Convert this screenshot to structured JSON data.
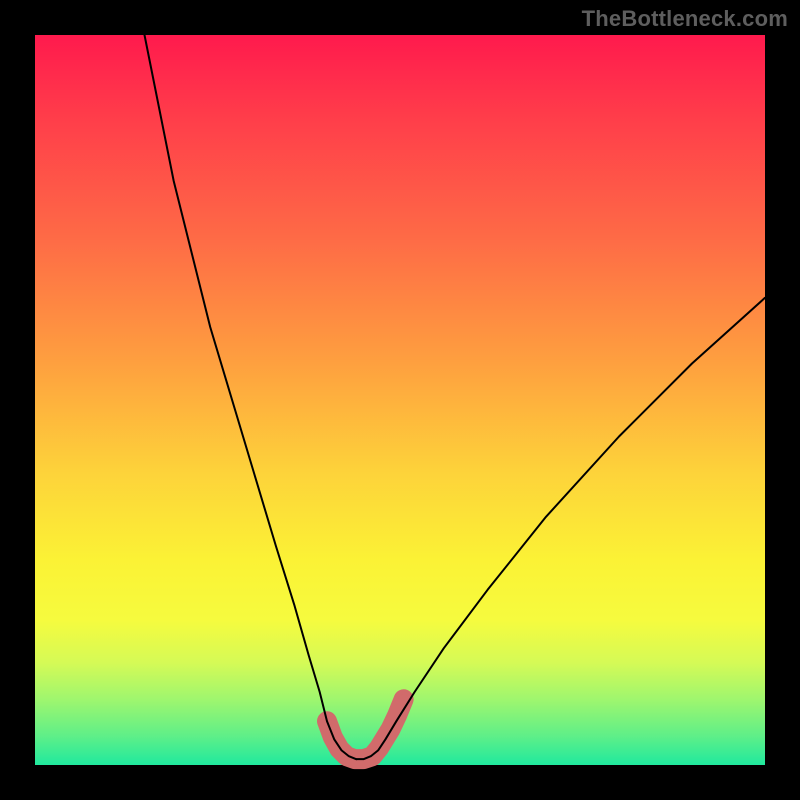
{
  "watermark": "TheBottleneck.com",
  "chart_data": {
    "type": "line",
    "title": "",
    "xlabel": "",
    "ylabel": "",
    "xlim": [
      0,
      100
    ],
    "ylim": [
      0,
      100
    ],
    "grid": false,
    "legend": false,
    "curves": {
      "left": {
        "stroke": "#000000",
        "width": 2,
        "points": [
          [
            15,
            100
          ],
          [
            17,
            90
          ],
          [
            19,
            80
          ],
          [
            21.5,
            70
          ],
          [
            24,
            60
          ],
          [
            27,
            50
          ],
          [
            30,
            40
          ],
          [
            33,
            30
          ],
          [
            35.5,
            22
          ],
          [
            37.5,
            15
          ],
          [
            39,
            10
          ],
          [
            40,
            6
          ],
          [
            41,
            3.5
          ],
          [
            42,
            2
          ],
          [
            43,
            1.2
          ],
          [
            44,
            0.8
          ]
        ]
      },
      "right": {
        "stroke": "#000000",
        "width": 2,
        "points": [
          [
            44,
            0.8
          ],
          [
            45,
            0.8
          ],
          [
            46,
            1.2
          ],
          [
            47,
            2
          ],
          [
            48,
            3.5
          ],
          [
            49.5,
            6
          ],
          [
            52,
            10
          ],
          [
            56,
            16
          ],
          [
            62,
            24
          ],
          [
            70,
            34
          ],
          [
            80,
            45
          ],
          [
            90,
            55
          ],
          [
            100,
            64
          ]
        ]
      }
    },
    "markers": {
      "color": "#d16b6b",
      "radius_px": 10,
      "cap_radius_px": 5,
      "points_pct": [
        [
          40.0,
          6.0
        ],
        [
          40.8,
          3.8
        ],
        [
          41.7,
          2.2
        ],
        [
          42.7,
          1.2
        ],
        [
          43.8,
          0.8
        ],
        [
          45.0,
          0.8
        ],
        [
          46.2,
          1.2
        ],
        [
          47.1,
          2.3
        ],
        [
          48.7,
          4.9
        ],
        [
          49.6,
          6.8
        ],
        [
          50.5,
          9.0
        ]
      ]
    }
  }
}
